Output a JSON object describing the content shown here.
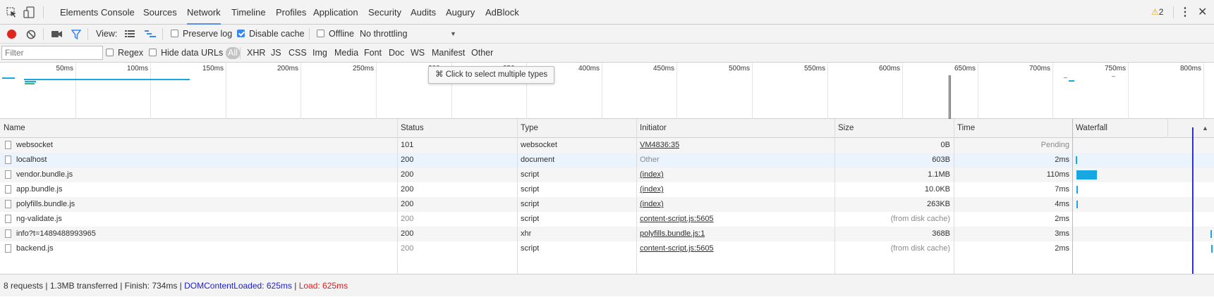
{
  "tabs": [
    "Elements",
    "Console",
    "Sources",
    "Network",
    "Timeline",
    "Profiles",
    "Application",
    "Security",
    "Audits",
    "Augury",
    "AdBlock"
  ],
  "active_tab": "Network",
  "warnings": {
    "count": "2"
  },
  "toolbar": {
    "view_label": "View:",
    "preserve_log": "Preserve log",
    "disable_cache": "Disable cache",
    "offline": "Offline",
    "throttling": "No throttling"
  },
  "filter": {
    "placeholder": "Filter",
    "regex": "Regex",
    "hide_data_urls": "Hide data URLs",
    "types": [
      "All",
      "XHR",
      "JS",
      "CSS",
      "Img",
      "Media",
      "Font",
      "Doc",
      "WS",
      "Manifest",
      "Other"
    ],
    "active_type": "All"
  },
  "overview": {
    "ticks": [
      "50ms",
      "100ms",
      "150ms",
      "200ms",
      "250ms",
      "300ms",
      "350ms",
      "400ms",
      "450ms",
      "500ms",
      "550ms",
      "600ms",
      "650ms",
      "700ms",
      "750ms",
      "800ms"
    ],
    "tooltip": "⌘ Click to select multiple types"
  },
  "columns": [
    "Name",
    "Status",
    "Type",
    "Initiator",
    "Size",
    "Time",
    "Waterfall"
  ],
  "rows": [
    {
      "name": "websocket",
      "status": "101",
      "type": "websocket",
      "initiator": "VM4836:35",
      "initiator_link": true,
      "size": "0B",
      "time": "Pending",
      "wf_start_ms": null,
      "wf_duration_ms": null
    },
    {
      "name": "localhost",
      "status": "200",
      "type": "document",
      "initiator": "Other",
      "initiator_link": false,
      "size": "603B",
      "time": "2ms",
      "wf_start_ms": 2,
      "wf_duration_ms": 2
    },
    {
      "name": "vendor.bundle.js",
      "status": "200",
      "type": "script",
      "initiator": "(index)",
      "initiator_link": true,
      "size": "1.1MB",
      "time": "110ms",
      "wf_start_ms": 8,
      "wf_duration_ms": 110
    },
    {
      "name": "app.bundle.js",
      "status": "200",
      "type": "script",
      "initiator": "(index)",
      "initiator_link": true,
      "size": "10.0KB",
      "time": "7ms",
      "wf_start_ms": 8,
      "wf_duration_ms": 7
    },
    {
      "name": "polyfills.bundle.js",
      "status": "200",
      "type": "script",
      "initiator": "(index)",
      "initiator_link": true,
      "size": "263KB",
      "time": "4ms",
      "wf_start_ms": 6,
      "wf_duration_ms": 4
    },
    {
      "name": "ng-validate.js",
      "status": "200",
      "type": "script",
      "initiator": "content-script.js:5605",
      "initiator_link": true,
      "size": "(from disk cache)",
      "time": "2ms",
      "wf_start_ms": null,
      "wf_duration_ms": null
    },
    {
      "name": "info?t=1489488993965",
      "status": "200",
      "type": "xhr",
      "initiator": "polyfills.bundle.js:1",
      "initiator_link": true,
      "size": "368B",
      "time": "3ms",
      "wf_start_ms": 740,
      "wf_duration_ms": 3
    },
    {
      "name": "backend.js",
      "status": "200",
      "type": "script",
      "initiator": "content-script.js:5605",
      "initiator_link": true,
      "size": "(from disk cache)",
      "time": "2ms",
      "wf_start_ms": 746,
      "wf_duration_ms": 2
    }
  ],
  "status": {
    "summary": "8 requests | 1.3MB transferred | Finish: 734ms | ",
    "dom": "DOMContentLoaded: 625ms",
    "sep": " | ",
    "load": "Load: 625ms"
  },
  "colors": {
    "accent": "#3a86f0",
    "record": "#e0241f",
    "waterfall": "#17a8e3",
    "dom": "#1c1cd1",
    "load": "#e01b1b"
  }
}
